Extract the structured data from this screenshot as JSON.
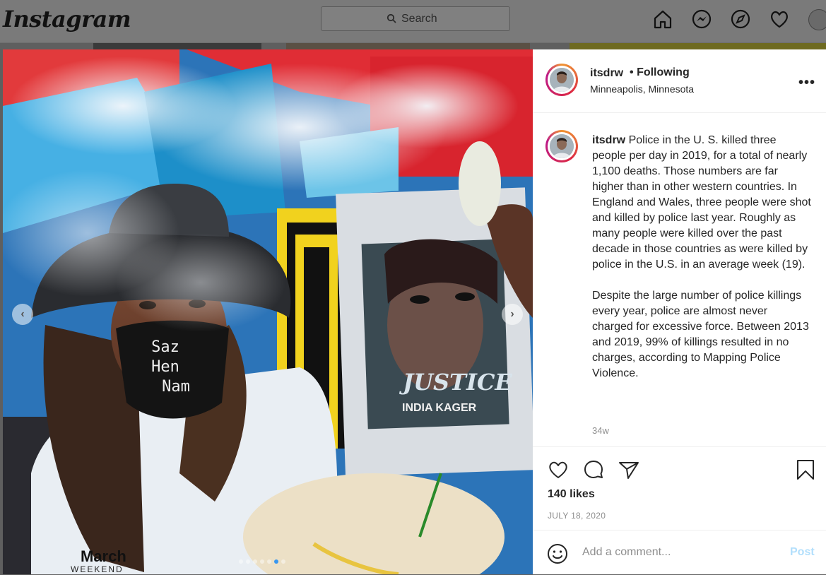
{
  "nav": {
    "logo": "Instagram",
    "search_placeholder": "Search",
    "icons": [
      "home-icon",
      "messenger-icon",
      "explore-icon",
      "activity-heart-icon",
      "profile-avatar"
    ]
  },
  "photo": {
    "sign_title": "JUSTICE",
    "sign_name": "INDIA KAGER",
    "mask_text": "Saz Her Name",
    "shirt_text": "March WEEKEND",
    "carousel": {
      "count": 7,
      "active_index": 5
    }
  },
  "post": {
    "username": "itsdrw",
    "follow_separator": "•",
    "follow_status": "Following",
    "location": "Minneapolis, Minnesota",
    "more_label": "•••",
    "caption_paragraphs": [
      "Police in the U. S. killed three people per day in 2019, for a total of nearly 1,100 deaths. Those numbers are far higher than in other western countries. In England and Wales, three people were shot and killed by police last year. Roughly as many people were killed over the past decade in those countries as were killed by police in the U.S. in an average week (19).",
      "Despite the large number of police killings every year, police are almost never charged for excessive force. Between 2013 and 2019, 99% of killings resulted in no charges, according to Mapping Police Violence."
    ],
    "time_ago": "34w",
    "likes": "140 likes",
    "date": "JULY 18, 2020",
    "comment_placeholder": "Add a comment...",
    "post_button": "Post"
  },
  "colors": {
    "link_disabled": "#b2dffc",
    "carousel_active": "#3897f0",
    "overlay": "#5f5f5f"
  }
}
